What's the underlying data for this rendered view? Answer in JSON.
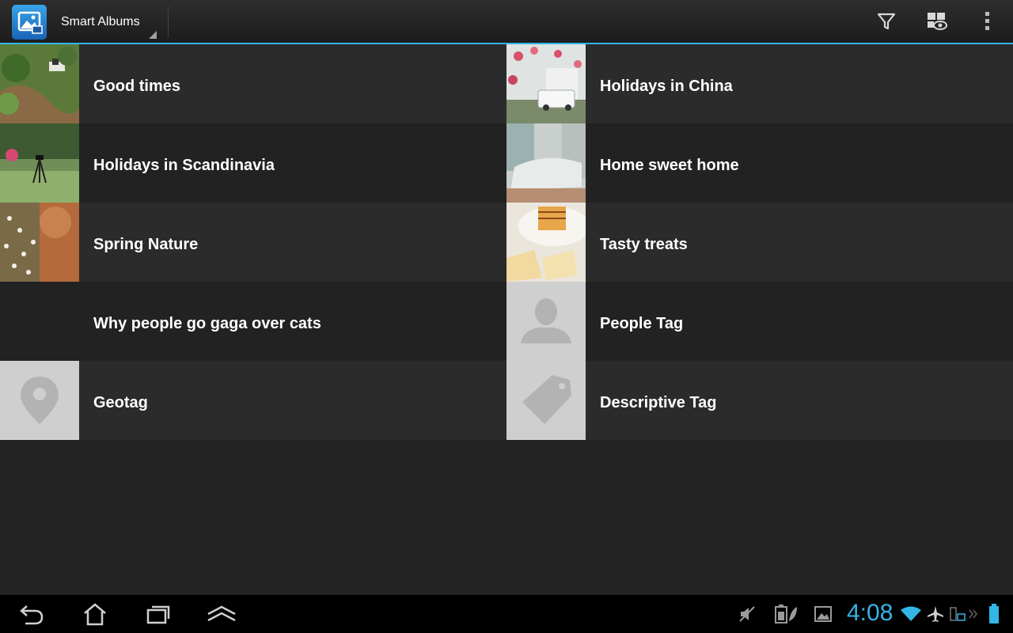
{
  "action_bar": {
    "title": "Smart Albums",
    "icons": [
      "gallery-app-icon",
      "filter-icon",
      "view-mode-icon",
      "overflow-menu-icon"
    ]
  },
  "albums": [
    {
      "label": "Good times",
      "thumb": "photo-garden"
    },
    {
      "label": "Holidays in China",
      "thumb": "photo-bus-blossoms"
    },
    {
      "label": "Holidays in Scandinavia",
      "thumb": "photo-park-tripod"
    },
    {
      "label": "Home sweet home",
      "thumb": "photo-bedroom"
    },
    {
      "label": "Spring Nature",
      "thumb": "photo-flowers"
    },
    {
      "label": "Tasty treats",
      "thumb": "photo-cakes"
    },
    {
      "label": "Why people go gaga over cats",
      "thumb": "none"
    },
    {
      "label": "People Tag",
      "thumb": "person-icon"
    },
    {
      "label": "Geotag",
      "thumb": "location-pin-icon"
    },
    {
      "label": "Descriptive Tag",
      "thumb": "tag-icon"
    }
  ],
  "system_bar": {
    "clock": "4:08",
    "nav_icons": [
      "back-icon",
      "home-icon",
      "recent-apps-icon",
      "menu-up-icon"
    ],
    "status_icons": [
      "mute-icon",
      "battery-saver-icon",
      "picture-icon",
      "wifi-icon",
      "airplane-icon",
      "battery-icon"
    ]
  },
  "colors": {
    "accent": "#33b5e5",
    "row_light": "#2b2b2b",
    "row_dark": "#222222"
  }
}
